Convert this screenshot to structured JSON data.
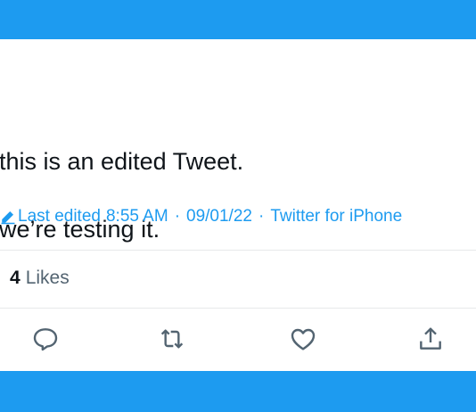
{
  "tweet": {
    "lines": [
      "this is an edited Tweet.",
      "we’re testing it."
    ],
    "edited_label": "Last edited",
    "time": "8:55 AM",
    "date": "09/01/22",
    "source": "Twitter for iPhone",
    "separator": "·"
  },
  "stats": {
    "likes_count": "4",
    "likes_label": "Likes"
  },
  "actions": [
    "reply-icon",
    "retweet-icon",
    "like-icon",
    "share-icon"
  ],
  "colors": {
    "accent": "#1d9bf0",
    "text": "#0f1419",
    "muted": "#536471",
    "divider": "#e7e9ea",
    "icon": "#536471"
  }
}
